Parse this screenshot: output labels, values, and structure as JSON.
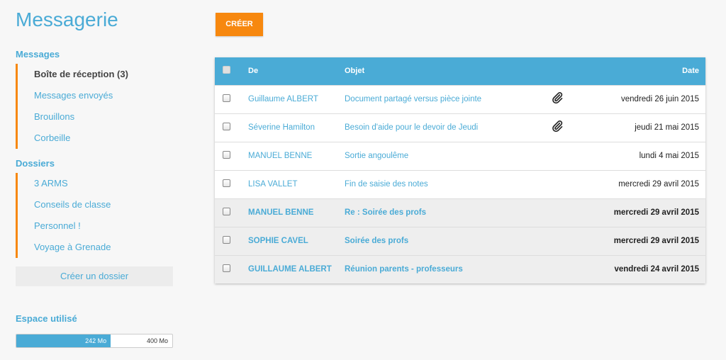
{
  "app": {
    "title": "Messagerie"
  },
  "sidebar": {
    "messages_title": "Messages",
    "messages": [
      {
        "label": "Boîte de réception (3)",
        "active": true
      },
      {
        "label": "Messages envoyés"
      },
      {
        "label": "Brouillons"
      },
      {
        "label": "Corbeille"
      }
    ],
    "folders_title": "Dossiers",
    "folders": [
      {
        "label": "3 ARMS"
      },
      {
        "label": "Conseils de classe"
      },
      {
        "label": "Personnel !"
      },
      {
        "label": "Voyage à Grenade"
      }
    ],
    "create_folder_label": "Créer un dossier",
    "storage_title": "Espace utilisé",
    "storage_used": "242 Mo",
    "storage_total": "400 Mo",
    "storage_fraction": 0.605
  },
  "toolbar": {
    "create_label": "CRÉER"
  },
  "table": {
    "headers": {
      "from": "De",
      "subject": "Objet",
      "date": "Date"
    },
    "rows": [
      {
        "from": "Guillaume ALBERT",
        "subject": "Document partagé versus pièce jointe",
        "date": "vendredi 26 juin 2015",
        "attachment": true,
        "unread": false
      },
      {
        "from": "Séverine Hamilton",
        "subject": "Besoin d'aide pour le devoir de Jeudi",
        "date": "jeudi 21 mai 2015",
        "attachment": true,
        "unread": false
      },
      {
        "from": "MANUEL BENNE",
        "subject": "Sortie angoulême",
        "date": "lundi 4 mai 2015",
        "attachment": false,
        "unread": false
      },
      {
        "from": "LISA VALLET",
        "subject": "Fin de saisie des notes",
        "date": "mercredi 29 avril 2015",
        "attachment": false,
        "unread": false
      },
      {
        "from": "MANUEL BENNE",
        "subject": "Re : Soirée des profs",
        "date": "mercredi 29 avril 2015",
        "attachment": false,
        "unread": true
      },
      {
        "from": "SOPHIE CAVEL",
        "subject": "Soirée des profs",
        "date": "mercredi 29 avril 2015",
        "attachment": false,
        "unread": true
      },
      {
        "from": "GUILLAUME ALBERT",
        "subject": "Réunion parents - professeurs",
        "date": "vendredi 24 avril 2015",
        "attachment": false,
        "unread": true
      }
    ]
  },
  "colors": {
    "accent": "#4aabd6",
    "orange": "#f7880f"
  },
  "icons": {
    "attachment": "paperclip-icon"
  }
}
